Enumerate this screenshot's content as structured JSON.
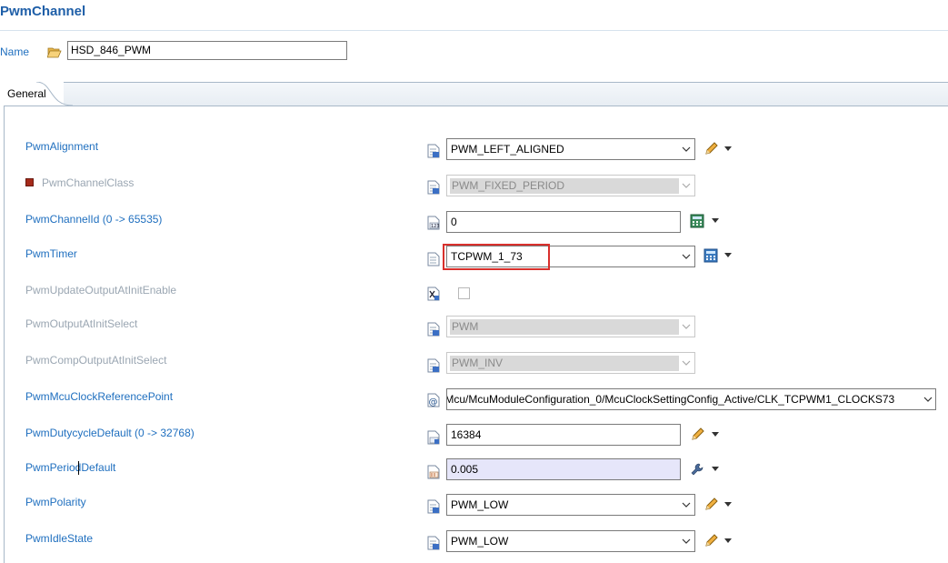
{
  "header": {
    "title": "PwmChannel"
  },
  "name_field": {
    "label": "Name",
    "value": "HSD_846_PWM"
  },
  "tabs": [
    {
      "label": "General",
      "selected": true
    }
  ],
  "rows": [
    {
      "label": "PwmAlignment",
      "value": "PWM_LEFT_ALIGNED",
      "enabled": true
    },
    {
      "label": "PwmChannelClass",
      "value": "PWM_FIXED_PERIOD",
      "enabled": false
    },
    {
      "label": "PwmChannelId (0 -> 65535)",
      "value": "0",
      "enabled": true
    },
    {
      "label": "PwmTimer",
      "value": "TCPWM_1_73",
      "enabled": true
    },
    {
      "label": "PwmUpdateOutputAtInitEnable",
      "checked": false,
      "enabled": false
    },
    {
      "label": "PwmOutputAtInitSelect",
      "value": "PWM",
      "enabled": false
    },
    {
      "label": "PwmCompOutputAtInitSelect",
      "value": "PWM_INV",
      "enabled": false
    },
    {
      "label": "PwmMcuClockReferencePoint",
      "value": "/Mcu/McuModuleConfiguration_0/McuClockSettingConfig_Active/CLK_TCPWM1_CLOCKS73",
      "enabled": true
    },
    {
      "label": "PwmDutycycleDefault (0 -> 32768)",
      "value": "16384",
      "enabled": true
    },
    {
      "label": "PwmPeriodDefault",
      "value": "0.005",
      "enabled": true
    },
    {
      "label": "PwmPolarity",
      "value": "PWM_LOW",
      "enabled": true
    },
    {
      "label": "PwmIdleState",
      "value": "PWM_LOW",
      "enabled": true
    }
  ],
  "colors": {
    "label_blue": "#1f6fbf",
    "title_blue": "#1f5fa8",
    "disabled_gray": "#9aa6b2",
    "highlight_red": "#d9302c",
    "lavender_field": "#e6e6fa"
  },
  "icons": {
    "name": "folder-open-icon",
    "row_param": "document-icon",
    "edit": "pencil-icon",
    "calculator": "calculator-icon",
    "reference": "at-sign-icon",
    "derived": "wrench-icon"
  }
}
